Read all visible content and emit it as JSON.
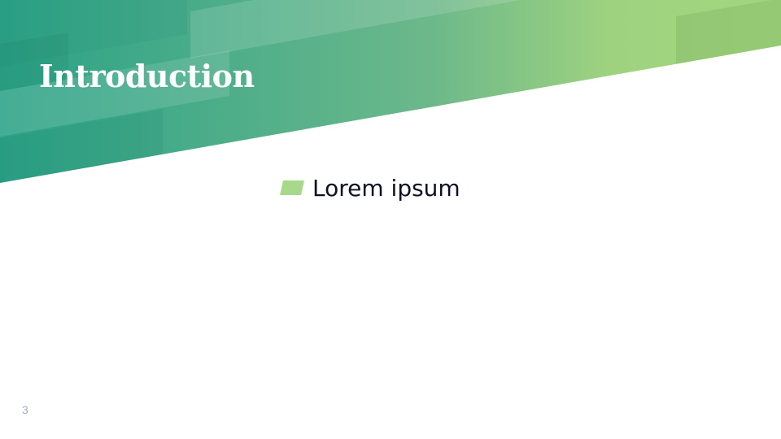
{
  "slide": {
    "title": "Introduction",
    "bullets": [
      {
        "text": "Lorem ipsum"
      }
    ],
    "page_number": "3"
  },
  "colors": {
    "gradient_start": "#2ba287",
    "gradient_end": "#a3d77e",
    "bullet_marker": "#a6d98a",
    "title_text": "#ffffff",
    "body_text": "#0d1026",
    "page_number": "#9bb0c4"
  }
}
